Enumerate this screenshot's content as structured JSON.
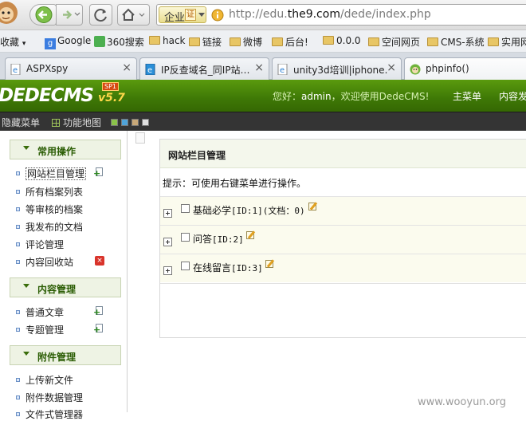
{
  "browser": {
    "address": {
      "badge": "企业",
      "cert": "证",
      "url_prefix": "http://edu.",
      "url_domain": "the9.com",
      "url_path": "/dede/index.php"
    },
    "bookmarks": [
      {
        "label": "收藏",
        "suffix": "▾"
      },
      {
        "label": "Google"
      },
      {
        "label": "360搜索"
      },
      {
        "label": "hack"
      },
      {
        "label": "链接"
      },
      {
        "label": "微博"
      },
      {
        "label": "后台!"
      },
      {
        "label": "0.0.0"
      },
      {
        "label": "空间网页"
      },
      {
        "label": "CMS-系统"
      },
      {
        "label": "实用网"
      }
    ],
    "tabs": [
      {
        "title": "ASPXspy",
        "close": "×"
      },
      {
        "title": "IP反查域名_同IP站…",
        "close": "×"
      },
      {
        "title": "unity3d培训|iphone…",
        "close": "×"
      },
      {
        "title": "phpinfo()",
        "close": "×"
      }
    ]
  },
  "cms": {
    "logo": "DEDECMS",
    "version": "v5.7",
    "sp": "SP1",
    "welcome_prefix": "您好：",
    "user": "admin",
    "welcome_suffix": "，欢迎使用DedeCMS!",
    "main_menu": "主菜单",
    "content_publish": "内容发布",
    "hide_menu": "隐藏菜单",
    "function_map": "功能地图",
    "swatches": [
      "#8bc34a",
      "#4fa3d9",
      "#c8a878",
      "#e0e0e0"
    ]
  },
  "sidebar": {
    "sections": [
      {
        "title": "常用操作",
        "items": [
          {
            "label": "网站栏目管理",
            "icon": "add-icon"
          },
          {
            "label": "所有档案列表"
          },
          {
            "label": "等审核的档案"
          },
          {
            "label": "我发布的文档"
          },
          {
            "label": "评论管理"
          },
          {
            "label": "内容回收站",
            "icon": "delete-icon"
          }
        ]
      },
      {
        "title": "内容管理",
        "items": [
          {
            "label": "普通文章",
            "icon": "add-icon"
          },
          {
            "label": "专题管理",
            "icon": "add-icon"
          }
        ]
      },
      {
        "title": "附件管理",
        "items": [
          {
            "label": "上传新文件"
          },
          {
            "label": "附件数据管理"
          },
          {
            "label": "文件式管理器"
          }
        ]
      }
    ]
  },
  "panel": {
    "title": "网站栏目管理",
    "tip": "提示：可使用右键菜单进行操作。",
    "rows": [
      {
        "name": "基础必学",
        "meta": "[ID:1](文档：0)"
      },
      {
        "name": "问答",
        "meta": "[ID:2]"
      },
      {
        "name": "在线留言",
        "meta": "[ID:3]"
      }
    ]
  },
  "watermark": "www.wooyun.org"
}
